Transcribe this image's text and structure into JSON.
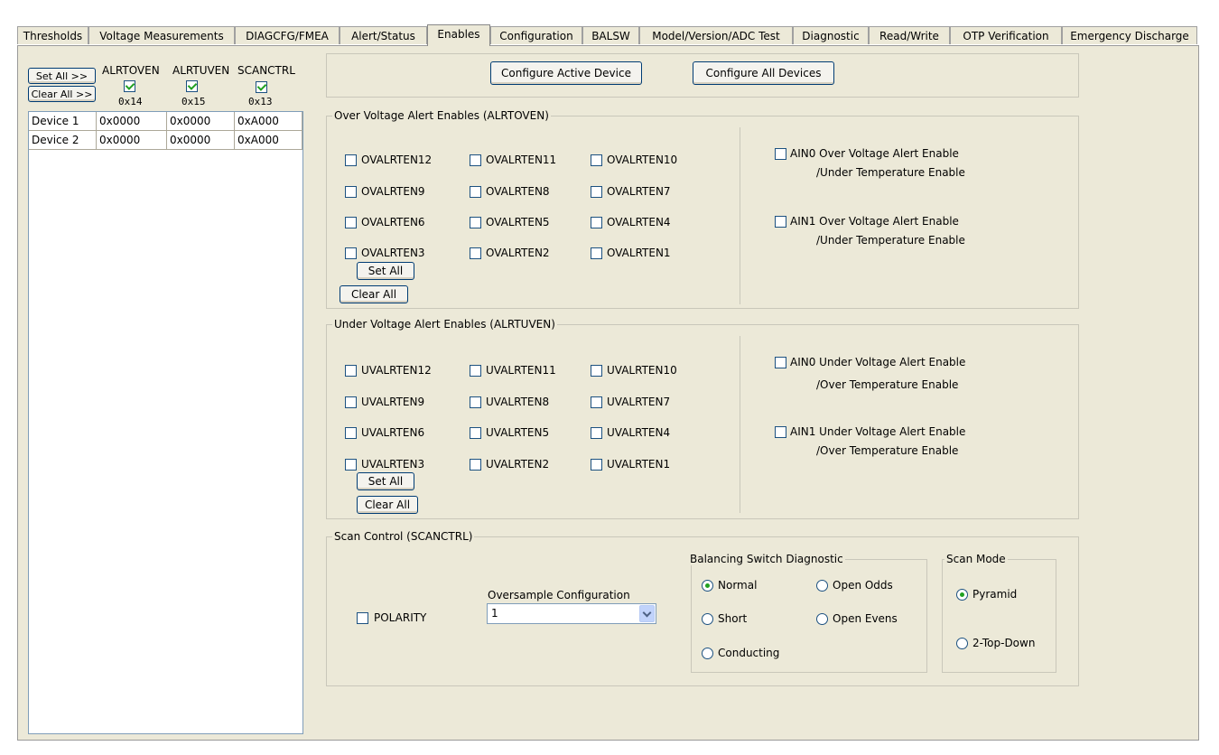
{
  "tabs": [
    {
      "label": "Thresholds"
    },
    {
      "label": "Voltage Measurements"
    },
    {
      "label": "DIAGCFG/FMEA"
    },
    {
      "label": "Alert/Status"
    },
    {
      "label": "Enables"
    },
    {
      "label": "Configuration"
    },
    {
      "label": "BALSW"
    },
    {
      "label": "Model/Version/ADC Test"
    },
    {
      "label": "Diagnostic"
    },
    {
      "label": "Read/Write"
    },
    {
      "label": "OTP Verification"
    },
    {
      "label": "Emergency Discharge"
    }
  ],
  "device_panel": {
    "set_all": "Set All >>",
    "clear_all": "Clear All >>",
    "columns": [
      {
        "name": "ALRTOVEN",
        "addr": "0x14",
        "checked": true
      },
      {
        "name": "ALRTUVEN",
        "addr": "0x15",
        "checked": true
      },
      {
        "name": "SCANCTRL",
        "addr": "0x13",
        "checked": true
      }
    ],
    "rows": [
      {
        "device": "Device 1",
        "values": [
          "0x0000",
          "0x0000",
          "0xA000"
        ]
      },
      {
        "device": "Device 2",
        "values": [
          "0x0000",
          "0x0000",
          "0xA000"
        ]
      }
    ]
  },
  "top_buttons": {
    "configure_active": "Configure Active Device",
    "configure_all": "Configure All Devices"
  },
  "ov_group": {
    "title": "Over Voltage Alert Enables (ALRTOVEN)",
    "items": [
      "OVALRTEN12",
      "OVALRTEN11",
      "OVALRTEN10",
      "OVALRTEN9",
      "OVALRTEN8",
      "OVALRTEN7",
      "OVALRTEN6",
      "OVALRTEN5",
      "OVALRTEN4",
      "OVALRTEN3",
      "OVALRTEN2",
      "OVALRTEN1"
    ],
    "set_all": "Set All",
    "clear_all": "Clear All",
    "ain0_line1": "AIN0 Over Voltage Alert Enable",
    "ain0_line2": "/Under Temperature Enable",
    "ain1_line1": "AIN1 Over Voltage Alert Enable",
    "ain1_line2": "/Under Temperature Enable"
  },
  "uv_group": {
    "title": "Under Voltage Alert Enables (ALRTUVEN)",
    "items": [
      "UVALRTEN12",
      "UVALRTEN11",
      "UVALRTEN10",
      "UVALRTEN9",
      "UVALRTEN8",
      "UVALRTEN7",
      "UVALRTEN6",
      "UVALRTEN5",
      "UVALRTEN4",
      "UVALRTEN3",
      "UVALRTEN2",
      "UVALRTEN1"
    ],
    "set_all": "Set All",
    "clear_all": "Clear All",
    "ain0_line1": "AIN0 Under Voltage Alert Enable",
    "ain0_line2": "/Over Temperature Enable",
    "ain1_line1": "AIN1 Under Voltage Alert Enable",
    "ain1_line2": "/Over Temperature Enable"
  },
  "scan_group": {
    "title": "Scan Control (SCANCTRL)",
    "polarity": "POLARITY",
    "oversample_label": "Oversample Configuration",
    "oversample_value": "1",
    "balancing": {
      "title": "Balancing Switch Diagnostic",
      "normal": "Normal",
      "open_odds": "Open Odds",
      "short": "Short",
      "open_evens": "Open Evens",
      "conducting": "Conducting",
      "selected": "Normal"
    },
    "scan_mode": {
      "title": "Scan Mode",
      "pyramid": "Pyramid",
      "top_down": "2-Top-Down",
      "selected": "Pyramid"
    }
  }
}
